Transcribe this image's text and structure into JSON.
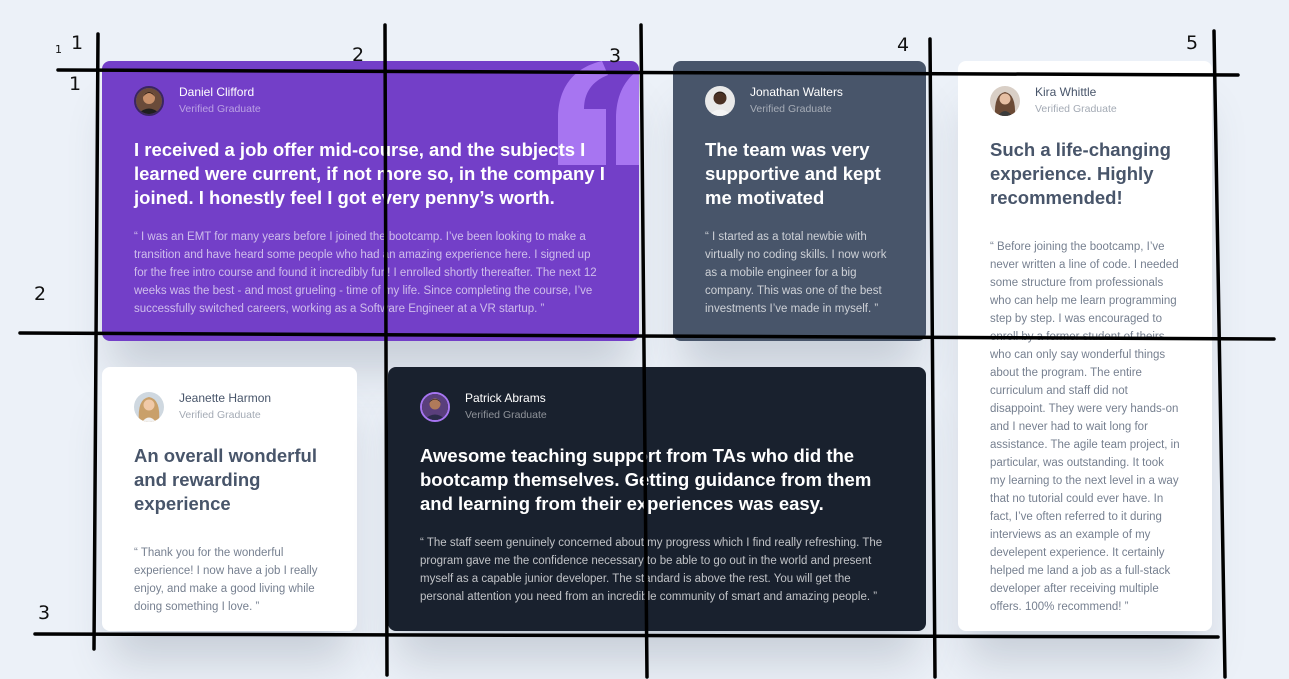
{
  "testimonials": [
    {
      "name": "Daniel Clifford",
      "subtitle": "Verified Graduate",
      "headline": "I received a job offer mid-course, and the subjects I learned were current, if not more so, in the company I joined. I honestly feel I got every penny’s worth.",
      "quote": "“ I was an EMT for many years before I joined the bootcamp. I’ve been looking to make a transition and have heard some people who had an amazing experience here. I signed up for the free intro course and found it incredibly fun! I enrolled shortly thereafter. The next 12 weeks was the  best - and most grueling - time of my life. Since completing the course, I’ve successfully switched careers, working as a Software Engineer at a VR startup. ”",
      "card_color": "#733fc8",
      "quote_icon_color": "#a775f1"
    },
    {
      "name": "Jonathan Walters",
      "subtitle": "Verified Graduate",
      "headline": "The team was very supportive and kept me motivated",
      "quote": "“ I started as a total newbie with virtually no coding skills. I now work as a mobile engineer for a big company. This was one of the best investments I’ve made in myself. ”",
      "card_color": "#48556a"
    },
    {
      "name": "Kira Whittle",
      "subtitle": "Verified Graduate",
      "headline": "Such a life-changing experience. Highly recommended!",
      "quote": "“ Before joining the bootcamp, I’ve never written a line of code. I needed some structure from professionals who can help me learn programming step by step. I was encouraged to enroll by a former student of theirs who can only say wonderful things about the program. The entire curriculum and staff did not disappoint. They were very hands-on and I never had to wait long for assistance. The agile team project, in particular, was outstanding. It took my learning to the next level in a way that no tutorial could ever have. In fact, I’ve often referred to it during interviews as an example of my develepent experience. It certainly helped me land a job as a full-stack developer after receiving multiple offers. 100% recommend! ”",
      "card_color": "#ffffff"
    },
    {
      "name": "Jeanette Harmon",
      "subtitle": "Verified Graduate",
      "headline": "An overall wonderful and rewarding experience",
      "quote": "“ Thank you for the wonderful experience! I now have a job I really enjoy, and make a good living while doing something I love. ”",
      "card_color": "#ffffff"
    },
    {
      "name": "Patrick Abrams",
      "subtitle": "Verified Graduate",
      "headline": "Awesome teaching support from TAs who did the bootcamp themselves. Getting guidance from them and learning from their experiences was easy.",
      "quote": "“ The staff seem genuinely concerned about my progress which I find really refreshing. The program gave me the confidence necessary to be able to go out in the world and present myself as a capable junior developer. The standard is above the rest. You will get the personal attention you need from an incredible community of smart and amazing people. ”",
      "card_color": "#19212e"
    }
  ],
  "annotations": {
    "column_numbers": [
      "1",
      "2",
      "3",
      "4",
      "5"
    ],
    "row_numbers": [
      "1",
      "2",
      "3"
    ],
    "corner_small": "1",
    "corner_row": "1"
  },
  "page_background": "#ecf1f8"
}
